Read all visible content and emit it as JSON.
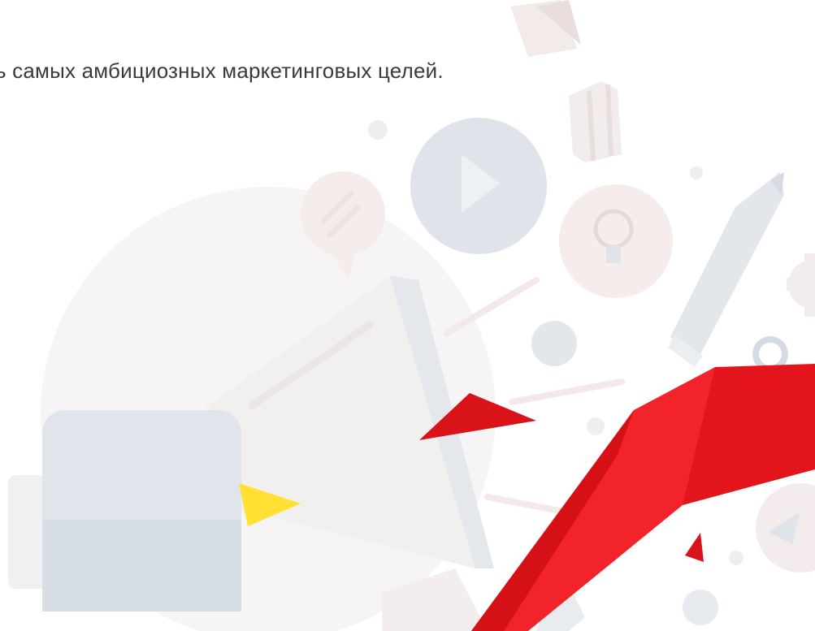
{
  "headline": "ь самых амбициозных маркетинговых целей.",
  "colors": {
    "background": "#ffffff",
    "text": "#3a3a3a",
    "accent_red": "#e3141b",
    "accent_yellow": "#ffe033",
    "pale_blue": "#dde3ea",
    "pale_pink": "#f6eeee"
  },
  "illustration": {
    "icons": [
      "megaphone-icon",
      "play-button-icon",
      "chat-bubble-icon",
      "lightbulb-icon",
      "pencil-icon",
      "gear-icon",
      "location-pin-icon",
      "rocket-icon",
      "paper-plane-icon",
      "red-ribbon"
    ]
  }
}
